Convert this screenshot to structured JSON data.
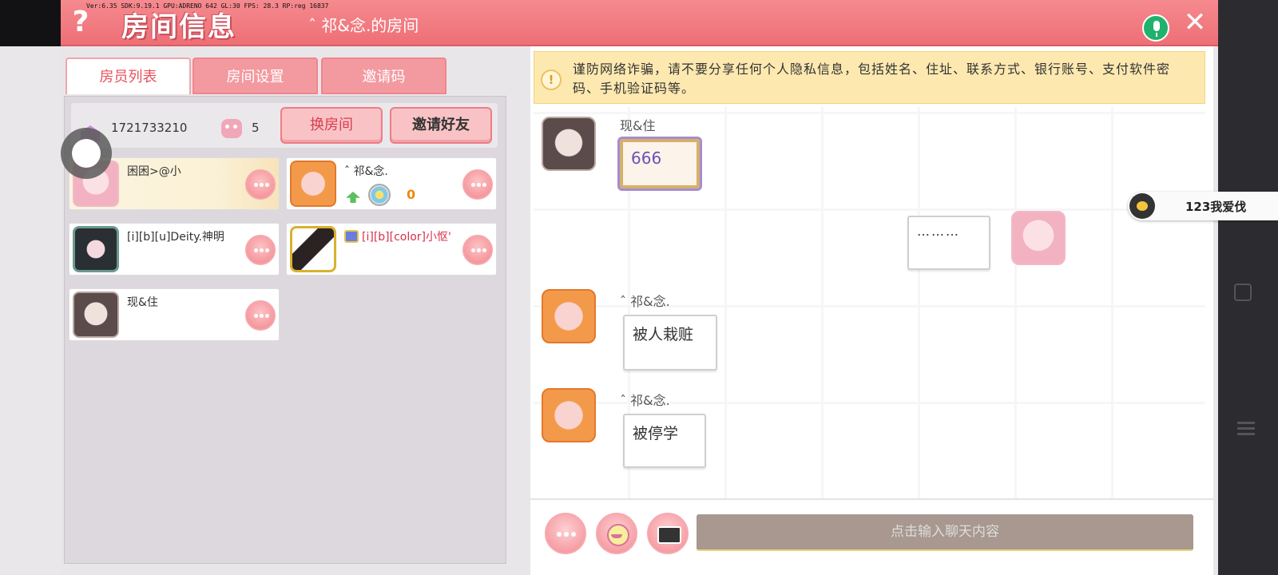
{
  "header": {
    "help_label": "?",
    "title": "房间信息",
    "room_name": "ˆ 祁&念.的房间",
    "debug_line": "Ver:6.35 SDK:9.19.1 GPU:ADRENO 642 GL:30 FPS: 28.3 RP:reg 16837",
    "close_label": "✕"
  },
  "tabs": [
    {
      "label": "房员列表"
    },
    {
      "label": "房间设置"
    },
    {
      "label": "邀请码"
    }
  ],
  "room_info": {
    "room_id": "1721733210",
    "member_count": "5",
    "change_room_label": "换房间",
    "invite_friend_label": "邀请好友"
  },
  "members": [
    {
      "name": "困困>@小"
    },
    {
      "name": "ˆ 祁&念.",
      "badge_value": "0"
    },
    {
      "name": "[i][b][u]Deity.神明"
    },
    {
      "name": "[i][b][color]小怄'"
    },
    {
      "name": "现&住"
    }
  ],
  "warning": {
    "icon_text": "!",
    "text": "谨防网络诈骗，请不要分享任何个人隐私信息，包括姓名、住址、联系方式、银行账号、支付软件密码、手机验证码等。"
  },
  "messages": [
    {
      "sender": "现&住",
      "text": "666"
    },
    {
      "sender": "",
      "text": "………"
    },
    {
      "sender": "ˆ 祁&念.",
      "text": "被人栽赃"
    },
    {
      "sender": "ˆ 祁&念.",
      "text": "被停学"
    }
  ],
  "input": {
    "placeholder": "点击输入聊天内容"
  },
  "side_chip": {
    "text": "123我爱伐"
  },
  "colors": {
    "header": "#ee6f76",
    "accent": "#e8505c",
    "warning_bg": "#fde9b0",
    "mic_green": "#20b26c"
  }
}
